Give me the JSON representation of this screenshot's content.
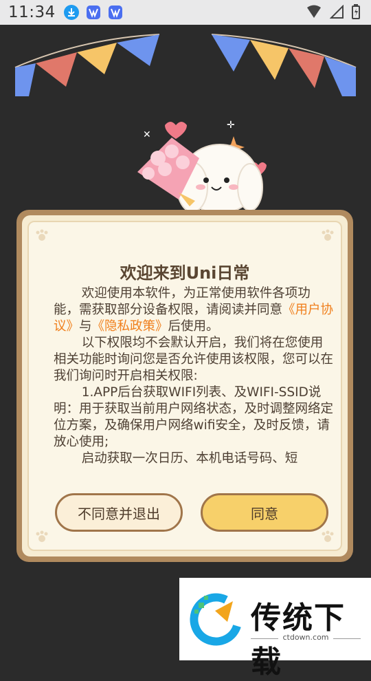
{
  "status_bar": {
    "time": "11:34"
  },
  "dialog": {
    "title": "欢迎来到Uni日常",
    "para1_prefix": "欢迎使用本软件，为正常使用软件各项功能，需获取部分设备权限，请阅读并同意",
    "link_terms": "《用户协议》",
    "connector": "与",
    "link_privacy": "《隐私政策》",
    "para1_suffix": "后使用。",
    "para2": "以下权限均不会默认开启，我们将在您使用相关功能时询问您是否允许使用该权限，您可以在我们询问时开启相关权限:",
    "para3": "1.APP后台获取WIFI列表、及WIFI-SSID说明：用于获取当前用户网络状态，及时调整网络定位方案，及确保用户网络wifi安全，及时反馈，请放心使用;",
    "para4": "启动获取一次日历、本机电话号码、短",
    "decline_label": "不同意并退出",
    "agree_label": "同意"
  },
  "watermark": {
    "title": "传统下载",
    "url": "ctdown.com"
  },
  "colors": {
    "accent_link": "#f0801e",
    "agree_button": "#f7d06a",
    "dialog_border": "#b08a5e"
  }
}
